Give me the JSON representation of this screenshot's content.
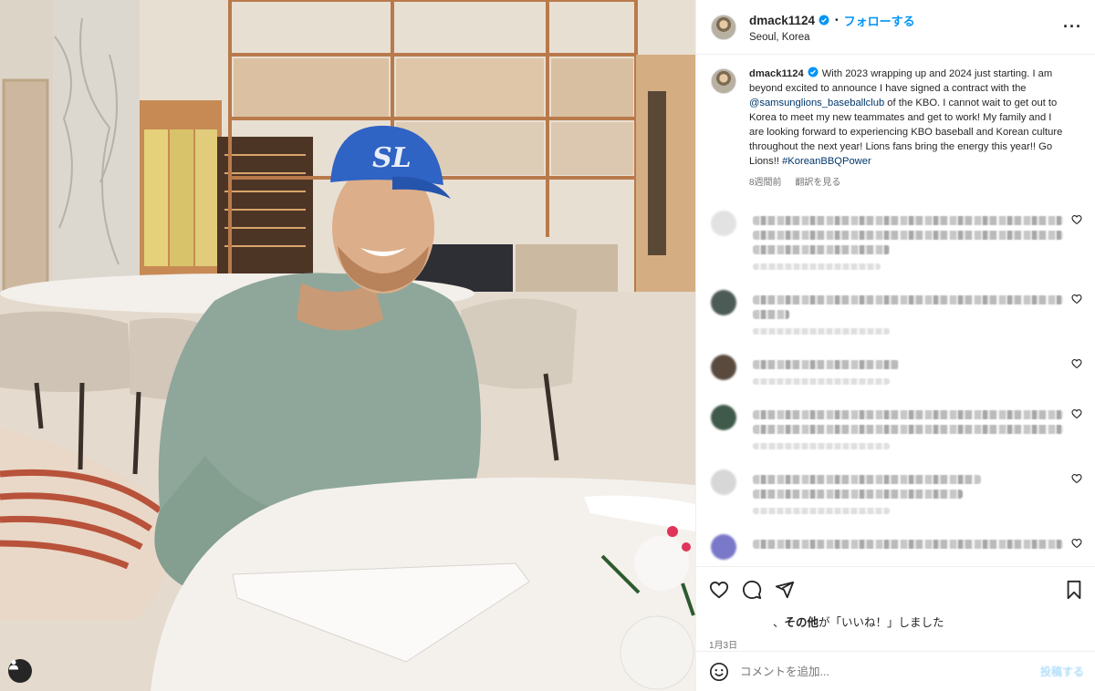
{
  "photo": {
    "cap_logo": "SL",
    "user_tag_icon": "person-icon"
  },
  "post": {
    "username": "dmack1124",
    "follow_label": "フォローする",
    "location": "Seoul, Korea",
    "more_icon": "more-horizontal-icon",
    "more_label": "...",
    "caption": {
      "text_before_tag": "With 2023 wrapping up and 2024 just starting. I am beyond excited to announce I have signed a contract with the ",
      "mention": "@samsunglions_baseballclub",
      "text_after_tag": " of the KBO. I cannot wait to get out to Korea to meet my new teammates and get to work! My family and I are looking forward to experiencing KBO baseball and Korean culture throughout the next year! Lions fans bring the energy this year!! Go Lions!! ",
      "hashtag": "#KoreanBBQPower",
      "age": "8週間前",
      "translate_label": "翻訳を見る"
    },
    "comments": [
      {
        "lines": 3,
        "avatar_color": "#e2e2e2"
      },
      {
        "lines": 2,
        "avatar_color": "#4d5b57"
      },
      {
        "lines": 1,
        "avatar_color": "#5a4a3e"
      },
      {
        "lines": 2,
        "avatar_color": "#3f5a4a"
      },
      {
        "lines": 2,
        "avatar_color": "#d7d7d7"
      },
      {
        "lines": 1,
        "avatar_color": "#7a78c8"
      }
    ],
    "actions": {
      "like_icon": "heart-icon",
      "comment_icon": "comment-icon",
      "share_icon": "send-icon",
      "save_icon": "bookmark-icon"
    },
    "likes_text_bold": "その他",
    "likes_text": "が「いいね！」しました",
    "likes_prefix": "、",
    "date": "1月3日",
    "composer": {
      "emoji_icon": "emoji-icon",
      "placeholder": "コメントを追加...",
      "post_label": "投稿する"
    }
  },
  "colors": {
    "link_blue": "#0095f6",
    "mention_navy": "#00376b",
    "verified_blue": "#0095f6",
    "cap_blue": "#2f63c4"
  }
}
